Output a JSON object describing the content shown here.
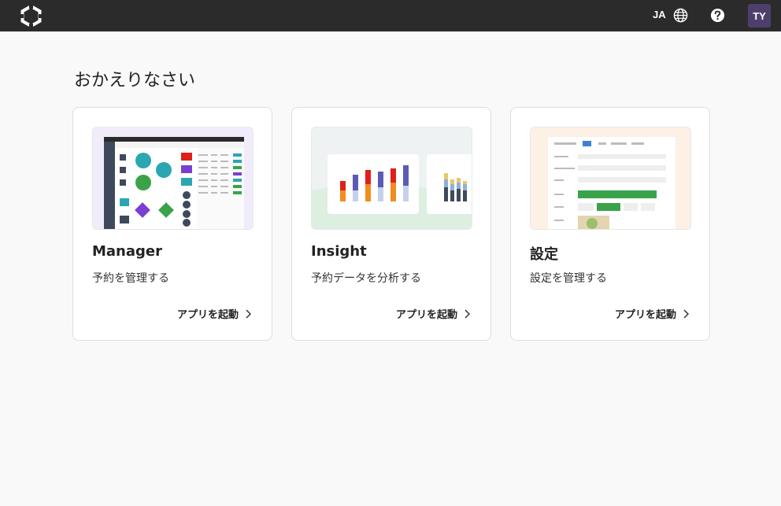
{
  "header": {
    "logo_icon": "hexagon-logo-icon",
    "language": "JA",
    "globe_icon": "globe-icon",
    "help_icon": "help-icon",
    "avatar_initials": "TY"
  },
  "main": {
    "welcome": "おかえりなさい",
    "cards": [
      {
        "title": "Manager",
        "description": "予約を管理する",
        "launch_label": "アプリを起動"
      },
      {
        "title": "Insight",
        "description": "予約データを分析する",
        "launch_label": "アプリを起動"
      },
      {
        "title": "設定",
        "description": "設定を管理する",
        "launch_label": "アプリを起動"
      }
    ]
  },
  "colors": {
    "topbar": "#2b2b2b",
    "avatar": "#4d3f6b",
    "card_border": "#dedede"
  }
}
